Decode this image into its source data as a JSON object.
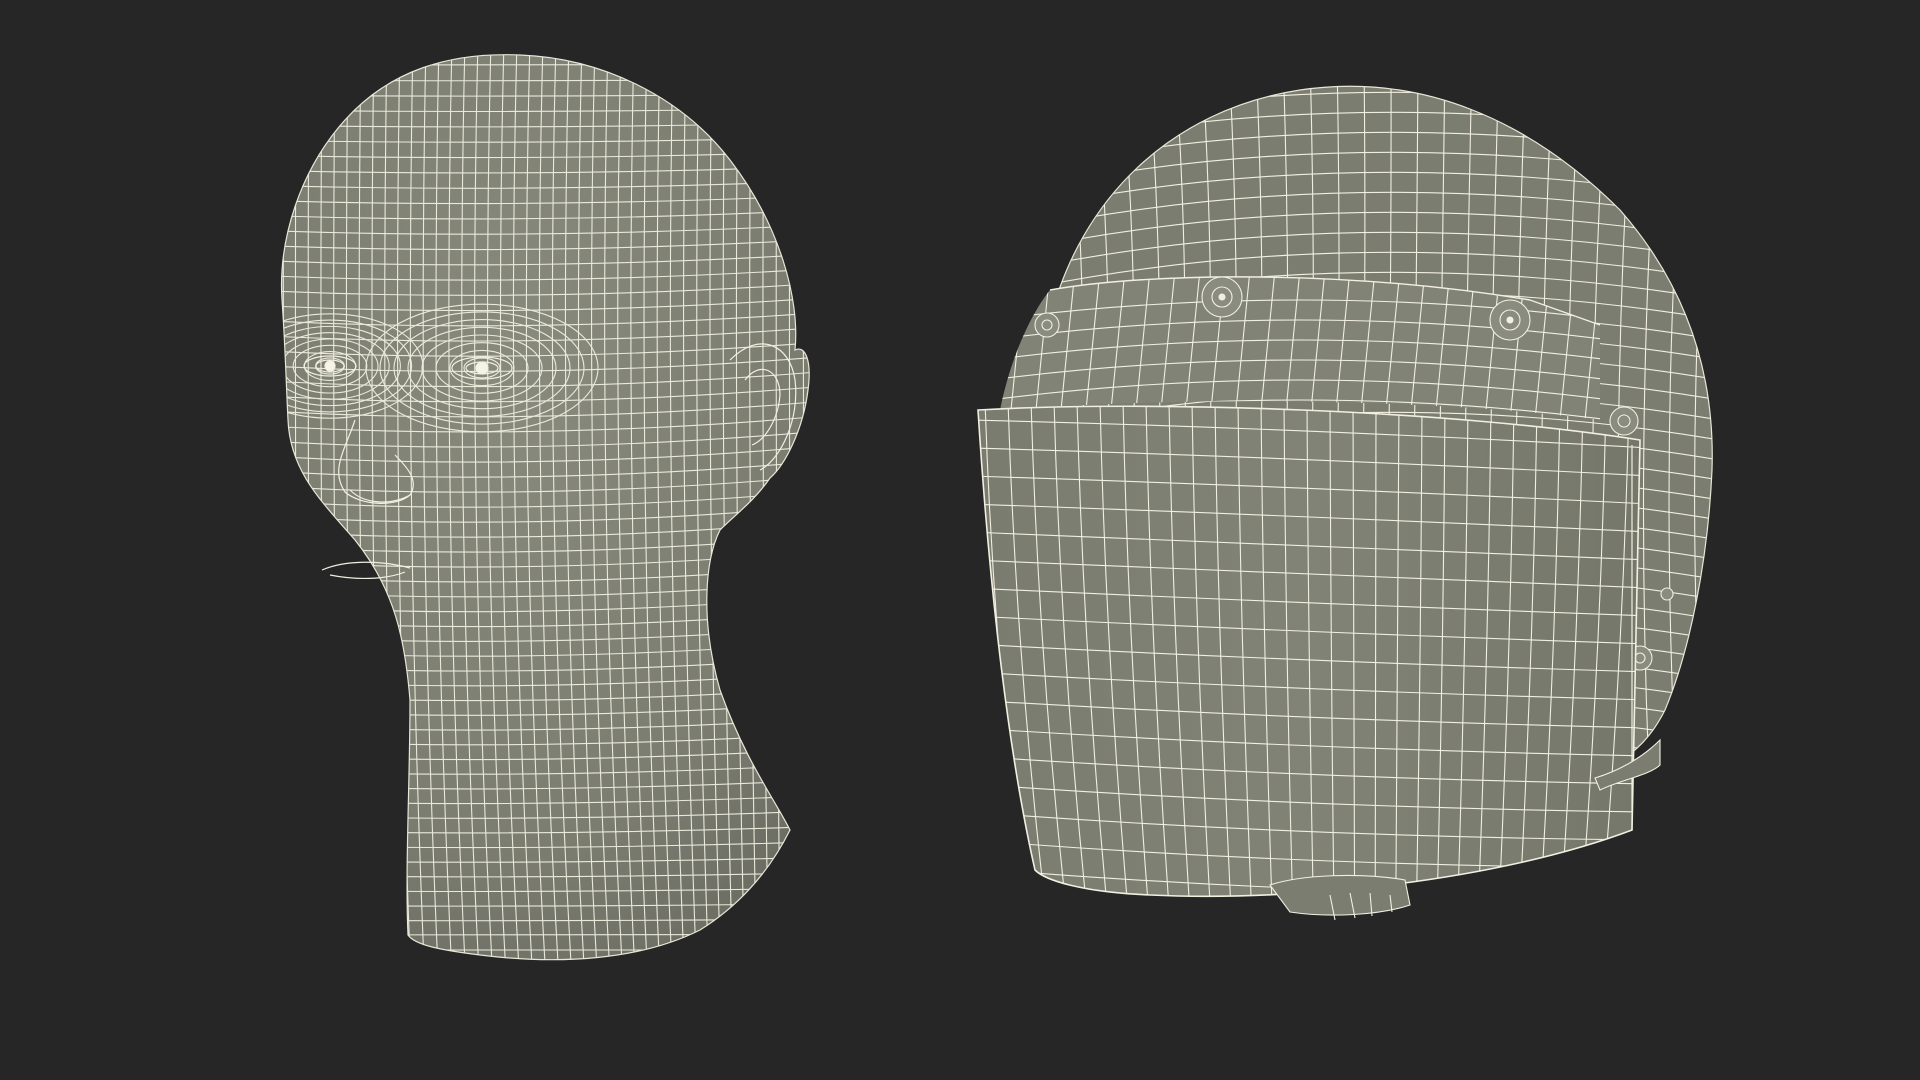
{
  "scene": {
    "background_color": "#262626",
    "surface_color": "#7c7e72",
    "wire_color": "#f1efe0",
    "objects": [
      {
        "name": "head-model",
        "kind": "wireframe head with neck"
      },
      {
        "name": "helmet-model",
        "kind": "wireframe helmet with visor"
      }
    ]
  }
}
